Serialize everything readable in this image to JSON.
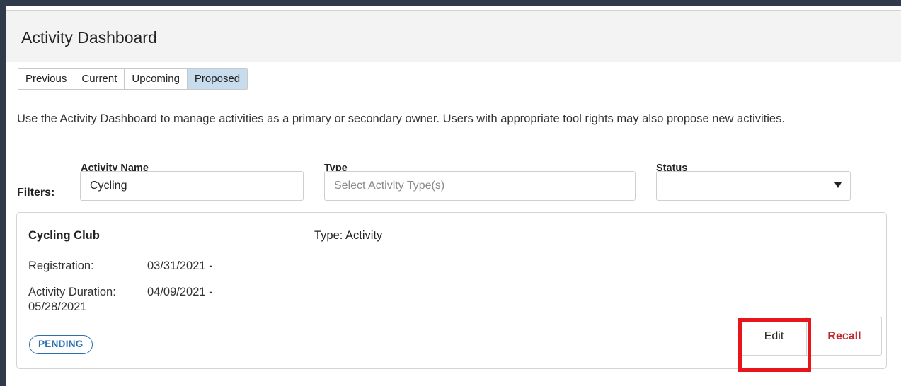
{
  "header": {
    "title": "Activity Dashboard"
  },
  "tabs": [
    {
      "label": "Previous",
      "active": false
    },
    {
      "label": "Current",
      "active": false
    },
    {
      "label": "Upcoming",
      "active": false
    },
    {
      "label": "Proposed",
      "active": true
    }
  ],
  "description": "Use the Activity Dashboard to manage activities as a primary or secondary owner. Users with appropriate tool rights may also propose new activities.",
  "filters": {
    "label": "Filters:",
    "activity_name": {
      "label": "Activity Name",
      "value": "Cycling"
    },
    "type": {
      "label": "Type",
      "placeholder": "Select Activity Type(s)"
    },
    "status": {
      "label": "Status",
      "value": ""
    }
  },
  "activity": {
    "name": "Cycling Club",
    "type": "Type: Activity",
    "registration_label": "Registration:",
    "registration_value": "03/31/2021 -",
    "duration_label": "Activity Duration:",
    "duration_value": "04/09/2021 -",
    "duration_end": "05/28/2021",
    "status_badge": "PENDING",
    "edit_label": "Edit",
    "recall_label": "Recall"
  },
  "colors": {
    "active_tab": "#c7dced",
    "badge": "#2a6fb0",
    "recall": "#c0262d",
    "highlight": "#e8161c"
  }
}
